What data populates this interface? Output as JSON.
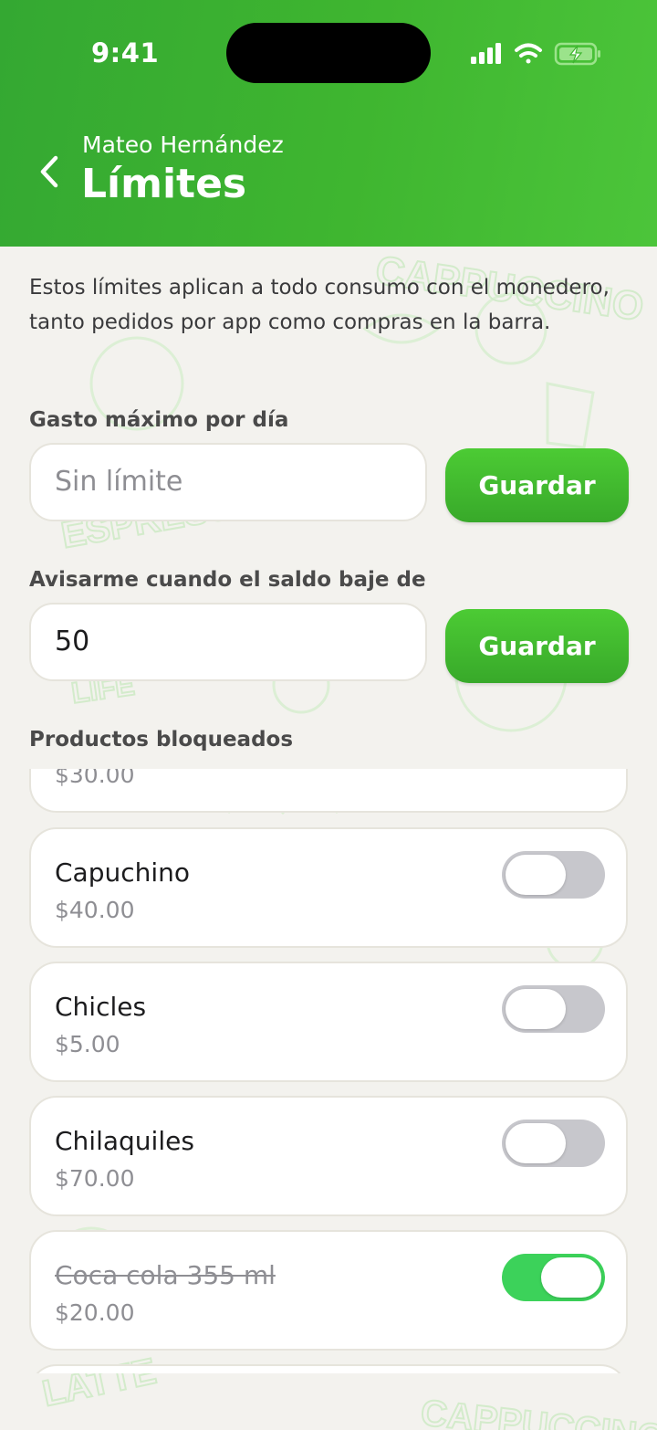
{
  "status_bar": {
    "time": "9:41"
  },
  "header": {
    "subtitle": "Mateo Hernández",
    "title": "Límites"
  },
  "intro_text": "Estos límites aplican a todo consumo con el monedero, tanto pedidos por app como compras en la barra.",
  "daily_max": {
    "label": "Gasto máximo por día",
    "placeholder": "Sin límite",
    "value": "",
    "save_label": "Guardar"
  },
  "low_balance": {
    "label": "Avisarme cuando el saldo baje de",
    "value": "50",
    "save_label": "Guardar"
  },
  "blocked_products": {
    "label": "Productos bloqueados",
    "items": [
      {
        "name": "",
        "price": "$30.00",
        "blocked": false
      },
      {
        "name": "Capuchino",
        "price": "$40.00",
        "blocked": false
      },
      {
        "name": "Chicles",
        "price": "$5.00",
        "blocked": false
      },
      {
        "name": "Chilaquiles",
        "price": "$70.00",
        "blocked": false
      },
      {
        "name": "Coca cola 355 ml",
        "price": "$20.00",
        "blocked": true
      }
    ]
  },
  "background_words": [
    "CAPPUCCINO",
    "ESPRESSO",
    "LIFE",
    "LATTE",
    "CAPPUCCINO"
  ],
  "colors": {
    "header_green": "#3fb630",
    "button_green": "#43bb30",
    "toggle_on": "#3cd25a",
    "toggle_off": "#c7c7cc",
    "background": "#f3f2ee"
  }
}
